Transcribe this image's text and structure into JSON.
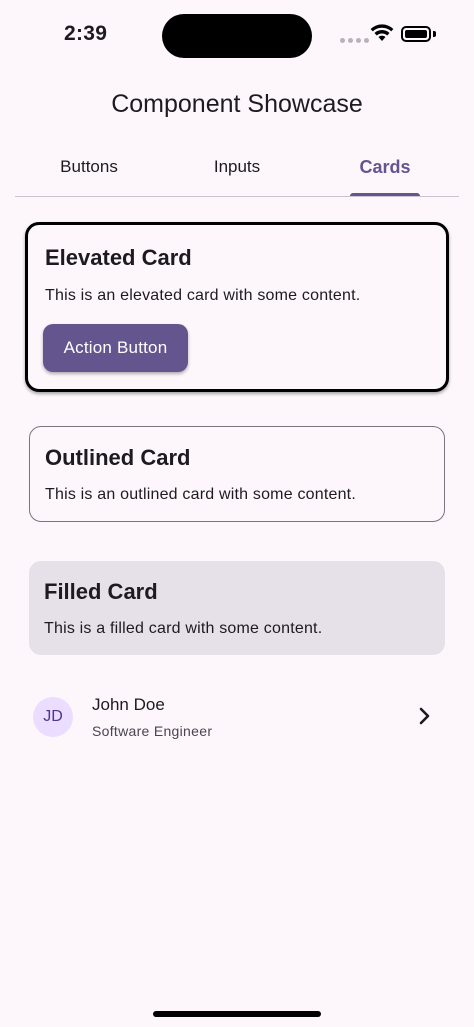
{
  "status_bar": {
    "time": "2:39"
  },
  "app": {
    "title": "Component Showcase"
  },
  "tabs": [
    {
      "label": "Buttons",
      "active": false
    },
    {
      "label": "Inputs",
      "active": false
    },
    {
      "label": "Cards",
      "active": true
    }
  ],
  "cards": {
    "elevated": {
      "title": "Elevated Card",
      "body": "This is an elevated card with some content.",
      "button_label": "Action Button"
    },
    "outlined": {
      "title": "Outlined Card",
      "body": "This is an outlined card with some content."
    },
    "filled": {
      "title": "Filled Card",
      "body": "This is a filled card with some content."
    }
  },
  "list_item": {
    "avatar_initials": "JD",
    "title": "John Doe",
    "subtitle": "Software Engineer",
    "trailing_icon": "chevron-right-icon"
  },
  "colors": {
    "background": "#fdf7fc",
    "primary": "#65558f",
    "filled_card": "#e6e0e9",
    "avatar_bg": "#eaddff"
  }
}
